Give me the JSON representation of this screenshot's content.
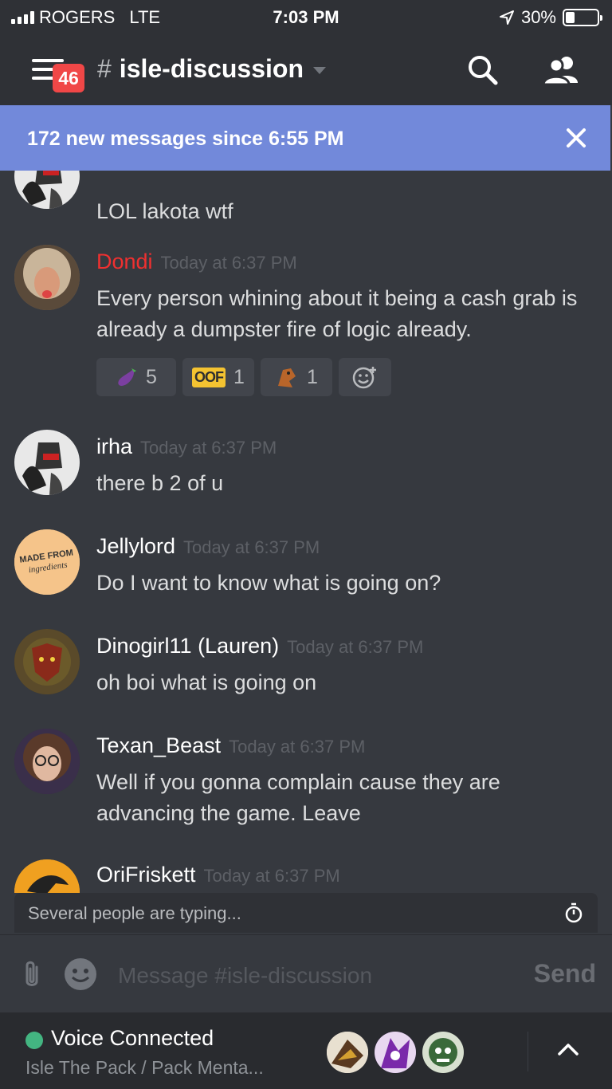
{
  "status_bar": {
    "carrier": "ROGERS",
    "network": "LTE",
    "time": "7:03 PM",
    "battery": "30%",
    "battery_level": 0.3
  },
  "header": {
    "unread_badge": "46",
    "channel_name": "isle-discussion"
  },
  "banner": {
    "text": "172 new messages since 6:55 PM"
  },
  "messages": [
    {
      "author": "",
      "timestamp": "",
      "text": "LOL lakota wtf",
      "avatar": "robot-avatar"
    },
    {
      "author": "Dondi",
      "author_color": "#f03030",
      "timestamp": "Today at 6:37 PM",
      "text": "Every person whining about it being a cash grab is already a dumpster fire of logic already.",
      "avatar": "wrestler-avatar",
      "reactions": [
        {
          "icon": "eggplant-icon",
          "count": "5"
        },
        {
          "icon": "oof-emote",
          "label": "OOF",
          "count": "1"
        },
        {
          "icon": "dino-emote-icon",
          "count": "1"
        }
      ]
    },
    {
      "author": "irha",
      "timestamp": "Today at 6:37 PM",
      "text": "there b 2 of u",
      "avatar": "robot-avatar"
    },
    {
      "author": "Jellylord",
      "timestamp": "Today at 6:37 PM",
      "text": "Do I want to know what is going on?",
      "avatar": "made-from-ingredients-avatar",
      "avatar_text_1": "MADE FROM",
      "avatar_text_2": "ingredients"
    },
    {
      "author": "Dinogirl11 (Lauren)",
      "timestamp": "Today at 6:37 PM",
      "text": "oh boi what is going on",
      "avatar": "dino-emblem-avatar"
    },
    {
      "author": "Texan_Beast",
      "timestamp": "Today at 6:37 PM",
      "text": "Well if you gonna complain cause they are advancing the game. Leave",
      "avatar": "girl-glasses-avatar"
    },
    {
      "author": "OriFriskett",
      "timestamp": "Today at 6:37 PM",
      "text": "",
      "avatar": "orange-dragon-avatar"
    }
  ],
  "typing": {
    "text": "Several people are typing..."
  },
  "composer": {
    "placeholder": "Message #isle-discussion",
    "send_label": "Send"
  },
  "voice": {
    "status": "Voice Connected",
    "channel": "Isle The Pack / Pack Menta..."
  },
  "colors": {
    "background": "#36393f",
    "header": "#2f3136",
    "banner": "#7289da",
    "badge": "#f04747",
    "online": "#43b581"
  }
}
